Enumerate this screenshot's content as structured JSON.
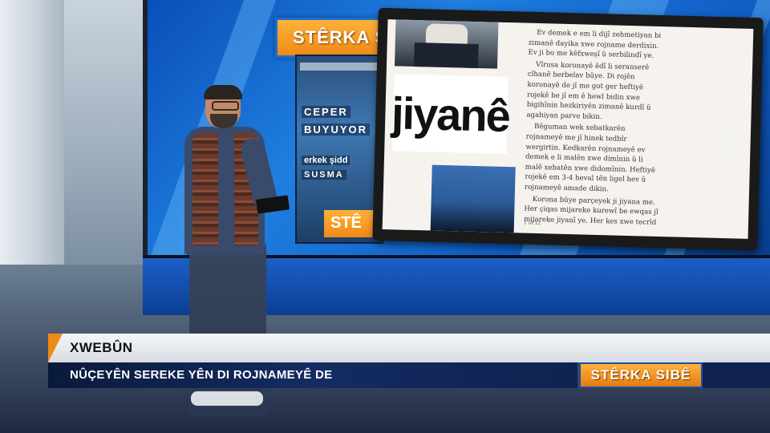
{
  "show_logo": {
    "wall_title": "STÊRKA SIBÊ",
    "wall_small": "STÊ"
  },
  "newspaper_thumbnail": {
    "words": [
      "CEPER",
      "BUYUYOR",
      "erkek şidd",
      "SUSMA"
    ]
  },
  "tablet": {
    "headline_word": "jiyanê",
    "page_indicator": "1 of 12",
    "article_paragraphs": [
      "Ev demek e em li dijî zehmetiyan bi zimanê dayika xwe rojname derdixin. Ev ji bo me kêfxweşî û serbilindî ye.",
      "Vîrusa koronayê êdî li seranserê cîhanê berbelav bûye. Di rojên koronayê de jî me got ger heftiyê rojekê be jî em ê hewl bidin xwe bigihînin hezkiriyên zimanê kurdî û agahiyan parve bikin.",
      "Bêguman wek xebatkarên rojnameyê me jî hinek tedbîr wergirtin. Kedkarên rojnameyê ev demek e li malên xwe dimînin û li malê xebatên xwe didomînin. Heftiyê rojekê em 3-4 heval tên ligel hev û rojnameyê amade dikin.",
      "Korona bûye parçeyek ji jiyana me. Her çiqas mijareke kurewî be ewqas jî mijareke jiyanî ye. Her kes xwe tecrîd"
    ]
  },
  "lower_third": {
    "category": "XWEBÛN",
    "headline": "NÛÇEYÊN SEREKE YÊN DI ROJNAMEYÊ DE",
    "logo_text": "STÊRKA SIBÊ"
  },
  "colors": {
    "brand_orange": "#f08a17",
    "wall_blue": "#1f7fe0",
    "lower_third_navy": "#142c63"
  }
}
